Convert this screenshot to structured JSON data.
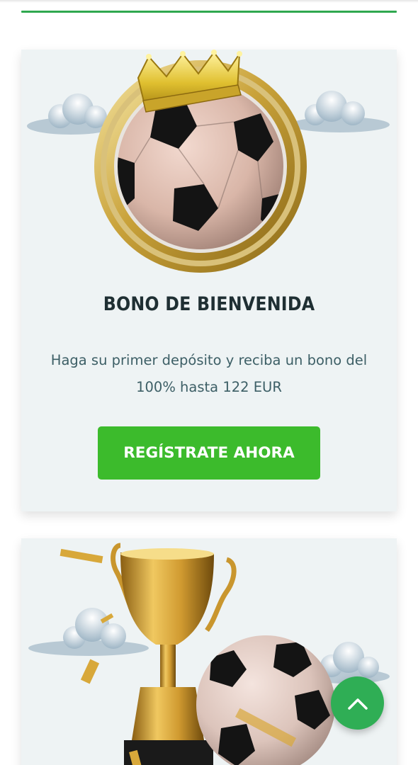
{
  "colors": {
    "accent_green": "#2fa84f",
    "button_green": "#3cbb2c",
    "card_background": "#eef3f4",
    "title_color": "#1f2f33",
    "text_color": "#3d5f66"
  },
  "welcome_bonus": {
    "title": "BONO DE BIENVENIDA",
    "description": "Haga su primer depósito y reciba un bono del 100% hasta 122 EUR",
    "cta_label": "REGÍSTRATE AHORA",
    "image": {
      "icons": [
        "crown-icon",
        "soccer-ball-icon",
        "gold-ring-icon",
        "cloud-icon"
      ]
    }
  },
  "second_promo": {
    "image": {
      "icons": [
        "trophy-icon",
        "soccer-ball-icon",
        "confetti-icon",
        "cloud-icon"
      ]
    }
  },
  "scroll_top": {
    "icon": "chevron-up-icon"
  }
}
